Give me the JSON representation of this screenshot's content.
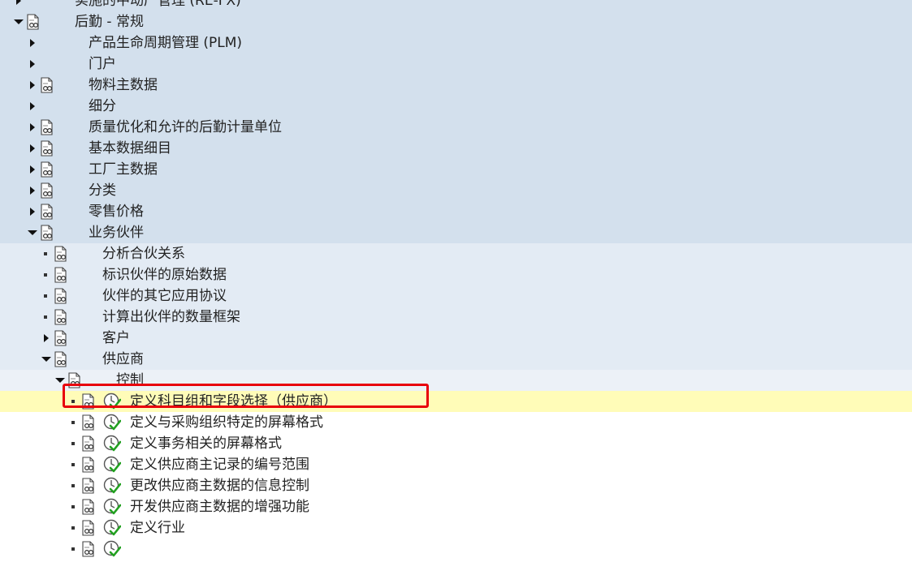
{
  "tree": {
    "rows": [
      {
        "label": "实施的中动产管理 (RE-FX)",
        "level": 0,
        "state": "collapsed",
        "doc": false,
        "clock": false
      },
      {
        "label": "后勤 - 常规",
        "level": 0,
        "state": "expanded",
        "doc": true,
        "clock": false
      },
      {
        "label": "产品生命周期管理 (PLM)",
        "level": 1,
        "state": "collapsed",
        "doc": false,
        "clock": false
      },
      {
        "label": "门户",
        "level": 1,
        "state": "collapsed",
        "doc": false,
        "clock": false
      },
      {
        "label": "物料主数据",
        "level": 1,
        "state": "collapsed",
        "doc": true,
        "clock": false
      },
      {
        "label": "细分",
        "level": 1,
        "state": "collapsed",
        "doc": false,
        "clock": false
      },
      {
        "label": "质量优化和允许的后勤计量单位",
        "level": 1,
        "state": "collapsed",
        "doc": true,
        "clock": false
      },
      {
        "label": "基本数据细目",
        "level": 1,
        "state": "collapsed",
        "doc": true,
        "clock": false
      },
      {
        "label": "工厂主数据",
        "level": 1,
        "state": "collapsed",
        "doc": true,
        "clock": false
      },
      {
        "label": "分类",
        "level": 1,
        "state": "collapsed",
        "doc": true,
        "clock": false
      },
      {
        "label": "零售价格",
        "level": 1,
        "state": "collapsed",
        "doc": true,
        "clock": false
      },
      {
        "label": "业务伙伴",
        "level": 1,
        "state": "expanded",
        "doc": true,
        "clock": false
      },
      {
        "label": "分析合伙关系",
        "level": 2,
        "state": "leaf",
        "doc": true,
        "clock": false
      },
      {
        "label": "标识伙伴的原始数据",
        "level": 2,
        "state": "leaf",
        "doc": true,
        "clock": false
      },
      {
        "label": "伙伴的其它应用协议",
        "level": 2,
        "state": "leaf",
        "doc": true,
        "clock": false
      },
      {
        "label": "计算出伙伴的数量框架",
        "level": 2,
        "state": "leaf",
        "doc": true,
        "clock": false
      },
      {
        "label": "客户",
        "level": 2,
        "state": "collapsed",
        "doc": true,
        "clock": false
      },
      {
        "label": "供应商",
        "level": 2,
        "state": "expanded",
        "doc": true,
        "clock": false
      },
      {
        "label": "控制",
        "level": 3,
        "state": "expanded",
        "doc": true,
        "clock": false
      },
      {
        "label": "定义科目组和字段选择（供应商）",
        "level": 4,
        "state": "leaf",
        "doc": true,
        "clock": true,
        "selected": true
      },
      {
        "label": "定义与采购组织特定的屏幕格式",
        "level": 4,
        "state": "leaf",
        "doc": true,
        "clock": true
      },
      {
        "label": "定义事务相关的屏幕格式",
        "level": 4,
        "state": "leaf",
        "doc": true,
        "clock": true
      },
      {
        "label": "定义供应商主记录的编号范围",
        "level": 4,
        "state": "leaf",
        "doc": true,
        "clock": true
      },
      {
        "label": "更改供应商主数据的信息控制",
        "level": 4,
        "state": "leaf",
        "doc": true,
        "clock": true
      },
      {
        "label": "开发供应商主数据的增强功能",
        "level": 4,
        "state": "leaf",
        "doc": true,
        "clock": true
      },
      {
        "label": "定义行业",
        "level": 4,
        "state": "leaf",
        "doc": true,
        "clock": true
      },
      {
        "label": "",
        "level": 4,
        "state": "leaf",
        "doc": true,
        "clock": true
      }
    ]
  },
  "colors": {
    "level0_bg": "#d3e0ed",
    "level2_bg": "#e3ebf4",
    "level3_bg": "#ecf1f7",
    "selected_bg": "#fffcb8",
    "highlight_border": "#e8000b"
  },
  "icons": {
    "doc": "documentation-icon",
    "clock": "execute-clock-icon",
    "expanded": "triangle-down-icon",
    "collapsed": "triangle-right-icon",
    "leaf": "bullet-icon"
  }
}
